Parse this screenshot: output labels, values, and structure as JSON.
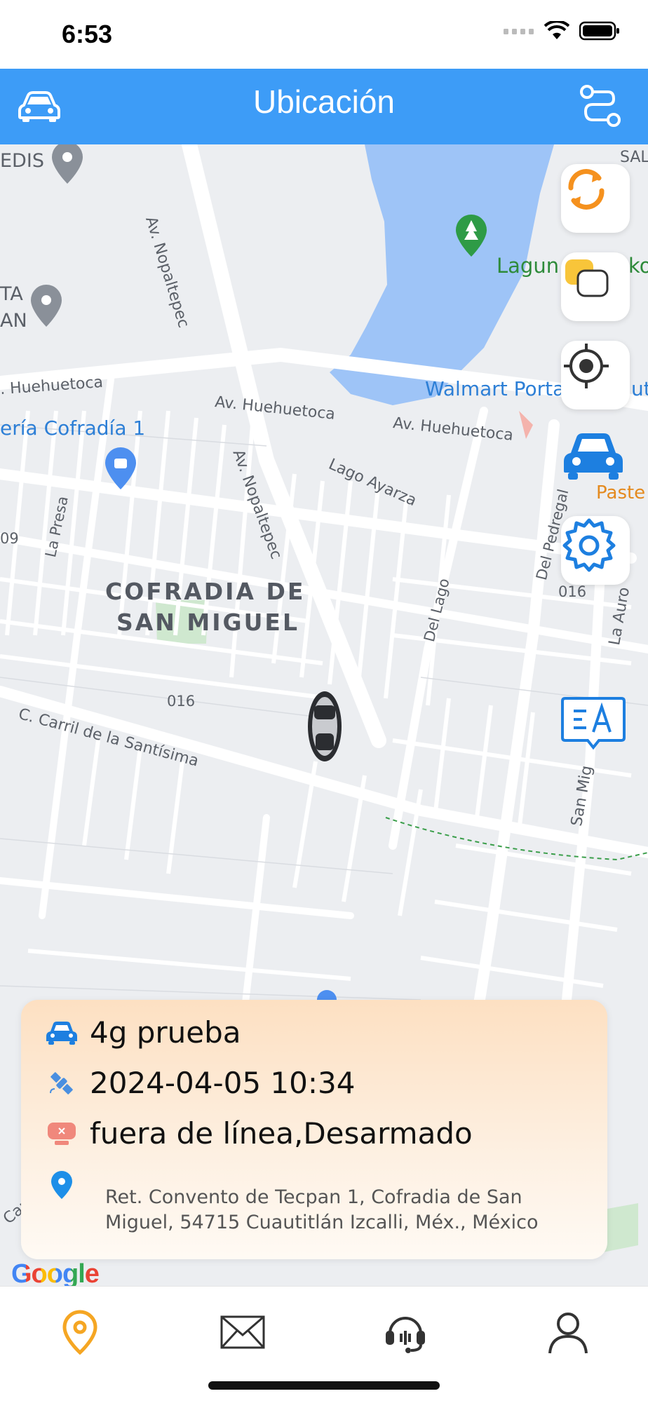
{
  "status_bar": {
    "time": "6:53"
  },
  "header": {
    "title": "Ubicación",
    "left_icon": "car-icon",
    "right_icon": "route-icon"
  },
  "map": {
    "labels": {
      "edis": "EDIS",
      "sal": "SAL",
      "av_nopaltepec_top": "Av. Nopaltepec",
      "ta": "TA",
      "an": "AN",
      "laguna": "Lagun",
      "ko": "ko",
      "walmart": "Walmart Porta",
      "uti": "uti",
      "huehuetoca_left": ". Huehuetoca",
      "av_huehuetoca_1": "Av. Huehuetoca",
      "av_huehuetoca_2": "Av. Huehuetoca",
      "cofradia_store": "ería Cofradía 1",
      "paste": "Paste",
      "av_nopaltepec_mid": "Av. Nopaltepec",
      "lago_ayarza": "Lago Ayarza",
      "la_presa": "La Presa",
      "num_09": "09",
      "del_lago": "Del Lago",
      "del_pedregal": "Del Pedregal",
      "num_016_right": "016",
      "la_aur": "La Auro",
      "hood_line1": "COFRADIA DE",
      "hood_line2": "SAN MIGUEL",
      "num_016_left": "016",
      "carril": "C. Carril de la Santísima",
      "san_mig": "San Mig",
      "car": "Car"
    },
    "side_buttons": [
      "refresh-icon",
      "layers-icon",
      "locate-icon",
      "vehicle-icon",
      "settings-icon",
      "translate-icon"
    ]
  },
  "info_card": {
    "vehicle_name": "4g prueba",
    "datetime": "2024-04-05 10:34",
    "status": "fuera de línea,Desarmado",
    "address": "Ret. Convento de Tecpan 1, Cofradia de San Miguel, 54715 Cuautitlán Izcalli, Méx., México"
  },
  "google_logo": "Google",
  "tabbar": {
    "tabs": [
      "location-icon",
      "mail-icon",
      "support-icon",
      "profile-icon"
    ],
    "active_index": 0
  },
  "colors": {
    "header_bg": "#3d9cf7",
    "accent_orange": "#f5a623",
    "water": "#9ec4f7",
    "map_bg": "#eceef1"
  }
}
